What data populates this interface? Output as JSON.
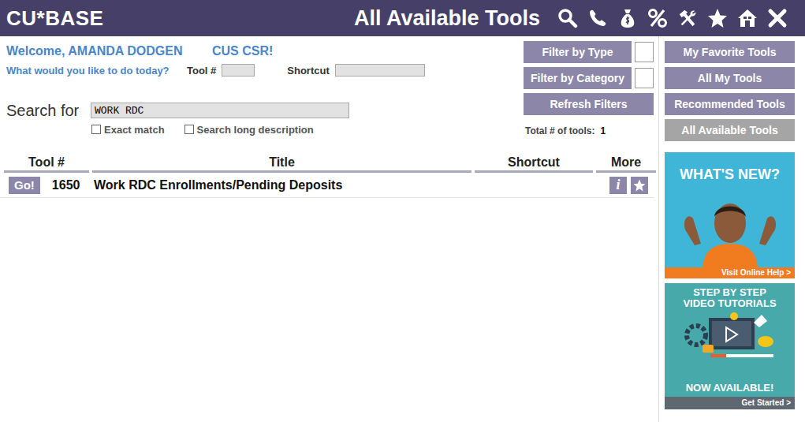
{
  "window": {
    "logo": "CU*BASE",
    "title": "All Available Tools"
  },
  "welcome": {
    "greeting": "Welcome, AMANDA DODGEN",
    "role": "CUS CSR!",
    "prompt": "What would you like to do today?"
  },
  "quick": {
    "tool_label": "Tool #",
    "tool_value": "",
    "shortcut_label": "Shortcut",
    "shortcut_value": ""
  },
  "search": {
    "label": "Search for",
    "value": "WORK RDC",
    "options": [
      {
        "label": "Exact match",
        "checked": false
      },
      {
        "label": "Search long description",
        "checked": false
      }
    ]
  },
  "filters": [
    {
      "label": "Filter by Type",
      "checked": false
    },
    {
      "label": "Filter by Category",
      "checked": false
    }
  ],
  "refresh": "Refresh Filters",
  "total": {
    "label": "Total # of tools:",
    "value": "1"
  },
  "table": {
    "columns": [
      "Tool #",
      "Title",
      "Shortcut",
      "More"
    ],
    "rows": [
      {
        "go": "Go!",
        "tool": "1650",
        "title": "Work RDC Enrollments/Pending Deposits",
        "shortcut": "",
        "info": "i",
        "favorite": false
      }
    ]
  },
  "nav": [
    {
      "label": "My Favorite Tools",
      "selected": false
    },
    {
      "label": "All My Tools",
      "selected": false
    },
    {
      "label": "Recommended Tools",
      "selected": false
    },
    {
      "label": "All Available Tools",
      "selected": true
    }
  ],
  "banners": [
    {
      "headline": "WHAT'S NEW?",
      "link": "Visit Online Help >"
    },
    {
      "headline": "STEP BY STEP VIDEO TUTORIALS",
      "footer": "NOW AVAILABLE!",
      "link": "Get Started >"
    }
  ]
}
